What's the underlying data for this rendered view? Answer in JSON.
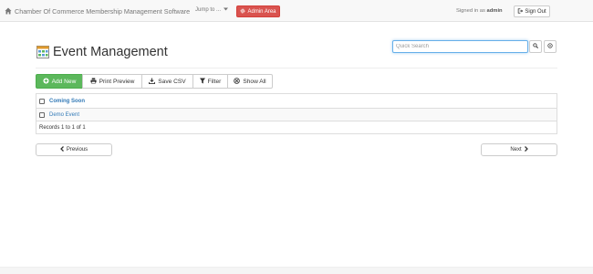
{
  "navbar": {
    "brand": "Chamber Of Commerce Membership Management Software",
    "jump_label": "Jump to ...",
    "admin_label": "Admin Area",
    "signed_prefix": "Signed in as",
    "username": "admin",
    "signout_label": "Sign Out"
  },
  "page": {
    "title": "Event Management",
    "search_placeholder": "Quick Search"
  },
  "toolbar": {
    "add_new": "Add New",
    "print_preview": "Print Preview",
    "save_csv": "Save CSV",
    "filter": "Filter",
    "show_all": "Show All"
  },
  "table": {
    "column_header": "Coming Soon",
    "rows": [
      {
        "name": "Demo Event"
      }
    ],
    "records_text": "Records 1 to 1 of 1"
  },
  "pager": {
    "previous": "Previous",
    "next": "Next"
  },
  "colors": {
    "admin_red": "#d9534f",
    "add_green": "#5cb85c",
    "link_blue": "#337ab7"
  },
  "icons": {
    "brand": "home-icon",
    "admin": "gear-icon",
    "signout": "sign-out-icon",
    "page": "calendar-table-icon",
    "search": "search-icon",
    "reset": "reset-icon",
    "add": "plus-circle-icon",
    "print": "print-icon",
    "csv": "download-icon",
    "filter": "filter-icon",
    "show_all": "times-circle-icon",
    "prev": "chevron-left-icon",
    "next": "chevron-right-icon"
  }
}
